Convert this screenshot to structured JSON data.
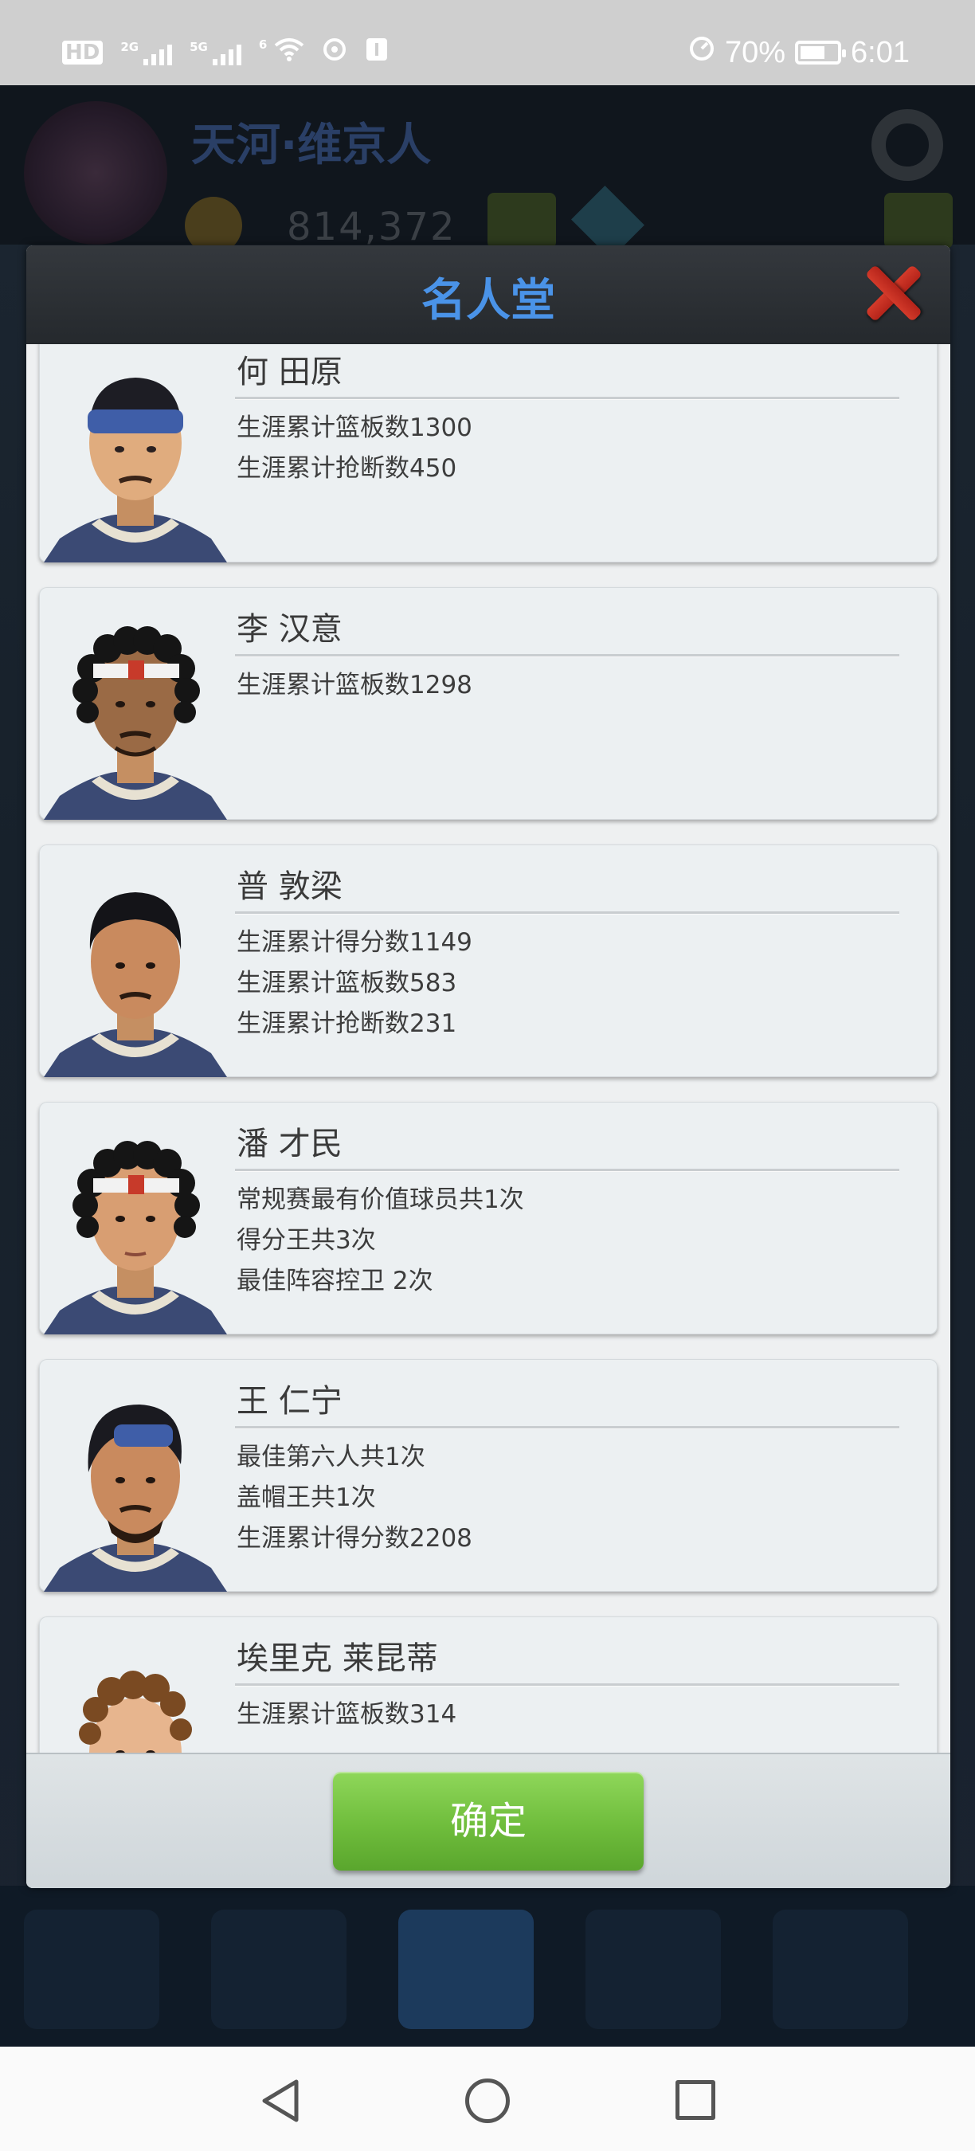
{
  "status_bar": {
    "network_labels": [
      "HD",
      "2G",
      "5G",
      "6"
    ],
    "battery_percent": "70%",
    "time": "6:01"
  },
  "background": {
    "team_name": "天河·维京人",
    "money": "814,372"
  },
  "dialog": {
    "title": "名人堂",
    "confirm_label": "确定",
    "players": [
      {
        "name": "何 田原",
        "stats": [
          "生涯累计篮板数1300",
          "生涯累计抢断数450"
        ]
      },
      {
        "name": "李 汉意",
        "stats": [
          "生涯累计篮板数1298"
        ]
      },
      {
        "name": "普 敦梁",
        "stats": [
          "生涯累计得分数1149",
          "生涯累计篮板数583",
          "生涯累计抢断数231"
        ]
      },
      {
        "name": "潘 才民",
        "stats": [
          "常规赛最有价值球员共1次",
          "得分王共3次",
          "最佳阵容控卫 2次"
        ]
      },
      {
        "name": "王 仁宁",
        "stats": [
          "最佳第六人共1次",
          "盖帽王共1次",
          "生涯累计得分数2208"
        ]
      },
      {
        "name": "埃里克 莱昆蒂",
        "stats": [
          "生涯累计篮板数314"
        ]
      }
    ]
  },
  "colors": {
    "title_blue": "#4a93e8",
    "confirm_green": "#6fbd3c",
    "close_red": "#c8301f"
  }
}
